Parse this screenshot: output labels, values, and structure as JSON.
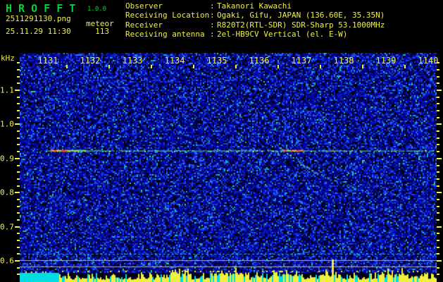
{
  "header": {
    "app_title": "H R O F F T",
    "version": "1.0.0",
    "filename": "2511291130.png",
    "mode": "meteor",
    "timestamp": "25.11.29 11:30",
    "count": "113",
    "separator": ":",
    "info": [
      {
        "label": "Observer",
        "value": "Takanori Kawachi"
      },
      {
        "label": "Receiving Location",
        "value": "Ogaki, Gifu, JAPAN (136.60E, 35.35N)"
      },
      {
        "label": "Receiver",
        "value": "R820T2(RTL-SDR) SDR-Sharp 53.1000MHz"
      },
      {
        "label": "Receiving antenna",
        "value": "2el-HB9CV Vertical (el. E-W)"
      }
    ]
  },
  "chart_data": {
    "type": "heatmap",
    "subtype": "radio-meteor-spectrogram",
    "title": "",
    "xlabel": "",
    "ylabel": "kHz",
    "x_ticks": [
      "1131",
      "1132",
      "1133",
      "1134",
      "1135",
      "1136",
      "1137",
      "1138",
      "1139",
      "1140"
    ],
    "y_ticks": [
      "1.1",
      "1.0",
      "0.9",
      "0.8",
      "0.7",
      "0.6"
    ],
    "y_range_khz": [
      0.55,
      1.21
    ],
    "x_range_hhmm": [
      1130.3,
      1140.2
    ],
    "grid": false,
    "legend": false,
    "features": {
      "carrier_line_khz": 0.923,
      "carrier_span_hhmm": [
        1130.95,
        1140.2
      ],
      "echo_bursts": [
        {
          "start_hhmm": 1131.05,
          "end_hhmm": 1131.47,
          "khz": 0.923,
          "intensity": "strong-red"
        },
        {
          "start_hhmm": 1131.47,
          "end_hhmm": 1131.9,
          "khz": 0.923,
          "intensity": "moderate-green"
        },
        {
          "start_hhmm": 1136.55,
          "end_hhmm": 1137.05,
          "khz": 0.923,
          "intensity": "strong-red"
        }
      ],
      "doppler_trace_hhmm_khz": [
        [
          1136.65,
          0.918
        ],
        [
          1137.0,
          0.885
        ],
        [
          1137.3,
          0.862
        ],
        [
          1137.65,
          0.842
        ],
        [
          1138.0,
          0.826
        ],
        [
          1138.35,
          0.814
        ]
      ],
      "dashed_line_khz": 0.62,
      "reference_lines_khz": [
        0.602,
        0.582
      ]
    },
    "noise_bar_strip": {
      "description": "yellow signal-level bars over cyan baseline along bottom edge",
      "top_khz": 0.59
    }
  },
  "colors": {
    "background": "#000000",
    "title_green": "#00d435",
    "text_yellow": "#f0f048",
    "noise_blue": "#0000a8",
    "speckle_cyan": "#00c8d0",
    "carrier_green": "#58e8a8",
    "echo_red": "#ff4010",
    "bar_yellow": "#f0f040",
    "bar_cyan": "#00dce0",
    "reference_gray": "#b0b0c0"
  }
}
